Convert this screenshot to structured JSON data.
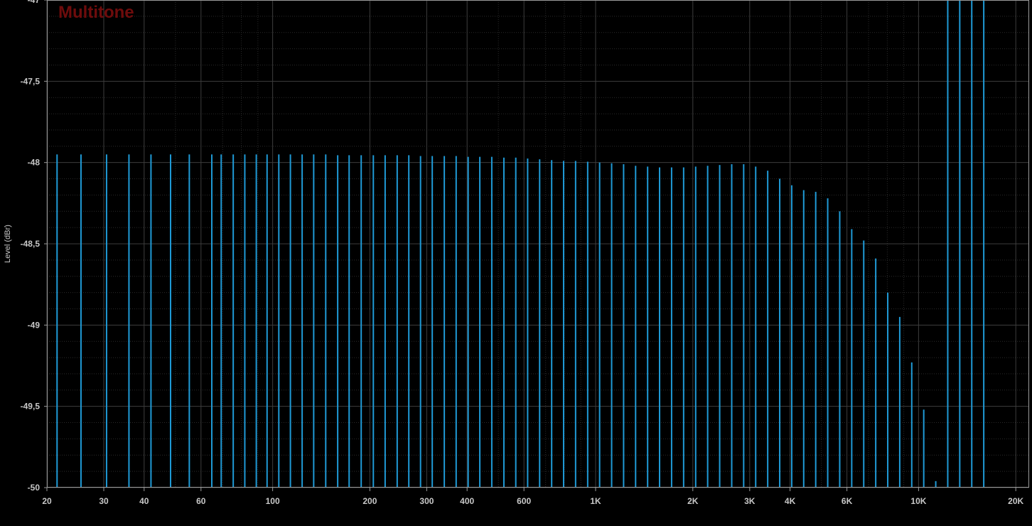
{
  "chart_data": {
    "type": "bar",
    "title": "Multitone",
    "ylabel": "Level (dBr)",
    "xlabel": "",
    "x_scale": "log",
    "xlim": [
      20,
      22000
    ],
    "ylim": [
      -50,
      -47
    ],
    "grid": true,
    "x_ticks": [
      {
        "value": 20,
        "label": "20"
      },
      {
        "value": 30,
        "label": "30"
      },
      {
        "value": 40,
        "label": "40"
      },
      {
        "value": 60,
        "label": "60"
      },
      {
        "value": 100,
        "label": "100"
      },
      {
        "value": 200,
        "label": "200"
      },
      {
        "value": 300,
        "label": "300"
      },
      {
        "value": 400,
        "label": "400"
      },
      {
        "value": 600,
        "label": "600"
      },
      {
        "value": 1000,
        "label": "1K"
      },
      {
        "value": 2000,
        "label": "2K"
      },
      {
        "value": 3000,
        "label": "3K"
      },
      {
        "value": 4000,
        "label": "4K"
      },
      {
        "value": 6000,
        "label": "6K"
      },
      {
        "value": 10000,
        "label": "10K"
      },
      {
        "value": 20000,
        "label": "20K"
      }
    ],
    "y_ticks": [
      {
        "value": -47,
        "label": "-47"
      },
      {
        "value": -47.5,
        "label": "-47,5"
      },
      {
        "value": -48,
        "label": "-48"
      },
      {
        "value": -48.5,
        "label": "-48,5"
      },
      {
        "value": -49,
        "label": "-49"
      },
      {
        "value": -49.5,
        "label": "-49,5"
      },
      {
        "value": -50,
        "label": "-50"
      }
    ],
    "x": [
      21.5,
      25.5,
      30.6,
      35.9,
      42.0,
      48.3,
      55.2,
      64.8,
      69.3,
      75.5,
      82.0,
      89.0,
      96.1,
      104.5,
      113.5,
      123.4,
      134.0,
      146.0,
      159.0,
      172.5,
      188.0,
      205.0,
      223.0,
      243.0,
      264.0,
      287.0,
      312.0,
      340.0,
      370.0,
      403.0,
      438.0,
      477.0,
      520.0,
      566.0,
      616.0,
      671.0,
      731.0,
      796.0,
      867.0,
      945.0,
      1029.0,
      1121.0,
      1221.0,
      1330.0,
      1449.0,
      1578.0,
      1719.0,
      1873.0,
      2041.0,
      2223.0,
      2422.0,
      2639.0,
      2874.0,
      3131.0,
      3411.0,
      3716.0,
      4048.0,
      4409.0,
      4803.0,
      5232.0,
      5700.0,
      6209.0,
      6764.0,
      7368.0,
      8027.0,
      8744.0,
      9525.0,
      10376.0,
      11303.0,
      12313.0,
      13413.0,
      14611.0,
      15916.0
    ],
    "values": [
      -47.95,
      -47.95,
      -47.95,
      -47.95,
      -47.95,
      -47.95,
      -47.95,
      -47.95,
      -47.95,
      -47.95,
      -47.95,
      -47.95,
      -47.95,
      -47.95,
      -47.95,
      -47.95,
      -47.95,
      -47.95,
      -47.955,
      -47.955,
      -47.955,
      -47.955,
      -47.955,
      -47.955,
      -47.955,
      -47.96,
      -47.96,
      -47.96,
      -47.96,
      -47.965,
      -47.965,
      -47.965,
      -47.97,
      -47.97,
      -47.975,
      -47.98,
      -47.985,
      -47.99,
      -47.99,
      -47.995,
      -48.0,
      -48.005,
      -48.01,
      -48.02,
      -48.025,
      -48.03,
      -48.03,
      -48.03,
      -48.025,
      -48.02,
      -48.015,
      -48.01,
      -48.01,
      -48.025,
      -48.05,
      -48.1,
      -48.14,
      -48.17,
      -48.18,
      -48.22,
      -48.3,
      -48.41,
      -48.48,
      -48.59,
      -48.8,
      -48.95,
      -49.23,
      -49.52,
      -49.96
    ]
  }
}
